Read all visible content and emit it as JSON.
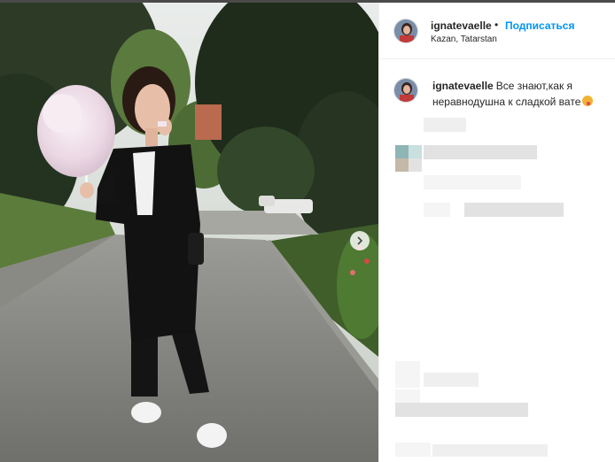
{
  "post": {
    "username": "ignatevaelle",
    "separator": "•",
    "follow_label": "Подписаться",
    "location": "Kazan, Tatarstan"
  },
  "caption": {
    "username": "ignatevaelle",
    "text": "Все знают,как я неравнодушна к сладкой вате"
  },
  "icons": [
    "avatar-photo",
    "chevron-right-icon",
    "emoji-yum-icon"
  ],
  "colors": {
    "follow_blue": "#0095f6",
    "text": "#262626",
    "border": "#efefef"
  }
}
